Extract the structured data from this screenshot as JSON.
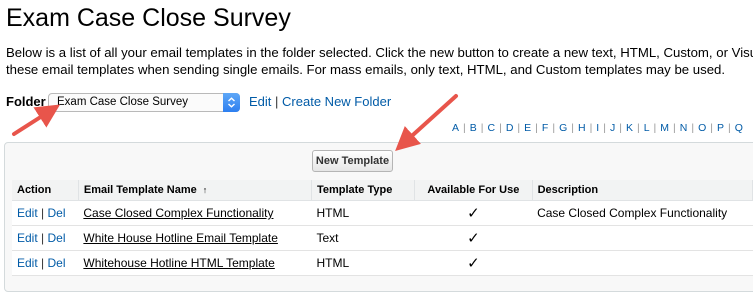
{
  "page": {
    "title": "Exam Case Close Survey",
    "description_line1": "Below is a list of all your email templates in the folder selected. Click the new button to create a new text, HTML, Custom, or Visua",
    "description_line2": "these email templates when sending single emails. For mass emails, only text, HTML, and Custom templates may be used."
  },
  "folder": {
    "label": "Folder",
    "selected": "Exam Case Close Survey",
    "edit_link": "Edit",
    "separator": "|",
    "create_link": "Create New Folder"
  },
  "alphabet": [
    "A",
    "B",
    "C",
    "D",
    "E",
    "F",
    "G",
    "H",
    "I",
    "J",
    "K",
    "L",
    "M",
    "N",
    "O",
    "P",
    "Q"
  ],
  "toolbar": {
    "new_template_label": "New Template"
  },
  "table": {
    "headers": {
      "action": "Action",
      "name": "Email Template Name",
      "sort_indicator": "↑",
      "type": "Template Type",
      "available": "Available For Use",
      "description": "Description"
    },
    "rows": [
      {
        "edit": "Edit",
        "sep": "|",
        "del": "Del",
        "name": "Case Closed Complex Functionality",
        "type": "HTML",
        "available": "✓",
        "description": "Case Closed Complex Functionality"
      },
      {
        "edit": "Edit",
        "sep": "|",
        "del": "Del",
        "name": "White House Hotline Email Template",
        "type": "Text",
        "available": "✓",
        "description": ""
      },
      {
        "edit": "Edit",
        "sep": "|",
        "del": "Del",
        "name": "Whitehouse Hotline HTML Template",
        "type": "HTML",
        "available": "✓",
        "description": ""
      }
    ]
  },
  "colors": {
    "link": "#015ba7",
    "arrow": "#e8554b",
    "select_accent": "#2d7ff0"
  },
  "icons": {
    "select_arrow": "updown-chevron-icon",
    "sort": "sort-ascending-icon",
    "check": "checkmark-icon"
  }
}
